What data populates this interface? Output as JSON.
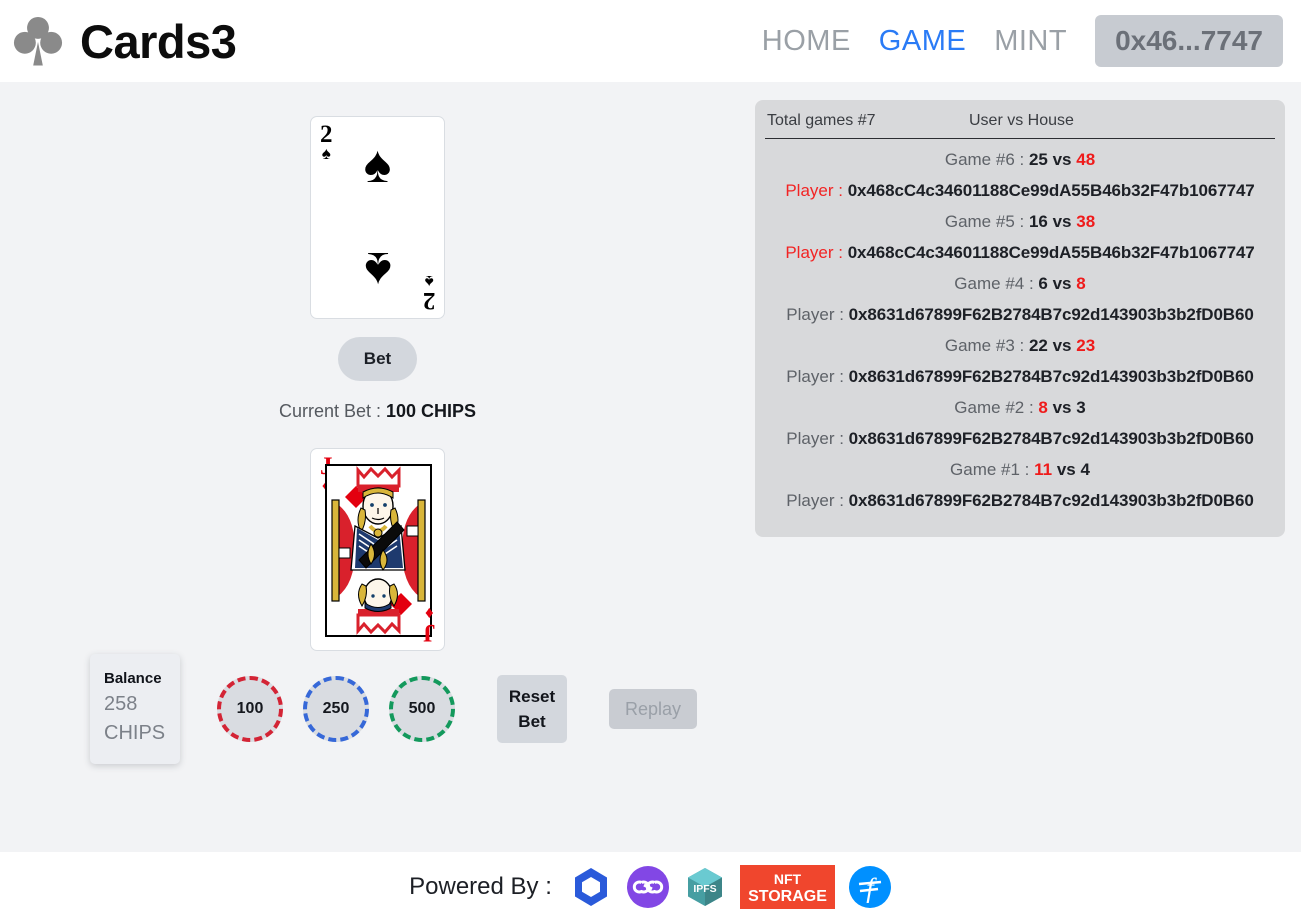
{
  "header": {
    "logo_icon": "club-suit-icon",
    "brand": "Cards3",
    "nav": [
      {
        "label": "HOME",
        "active": false
      },
      {
        "label": "GAME",
        "active": true
      },
      {
        "label": "MINT",
        "active": false
      }
    ],
    "wallet": "0x46...7747",
    "active_color": "#2a7bf6"
  },
  "game": {
    "house_card": {
      "rank": "2",
      "suit": "spade",
      "suit_glyph": "♠",
      "color": "black"
    },
    "player_card": {
      "rank": "J",
      "suit": "diamond",
      "suit_glyph": "♦",
      "color": "red"
    },
    "bet_button": "Bet",
    "current_bet_label": "Current Bet : ",
    "current_bet_value": "100 CHIPS"
  },
  "controls": {
    "balance_title": "Balance",
    "balance_value": "258",
    "balance_unit": "CHIPS",
    "chips": [
      {
        "value": "100",
        "color": "#d32435"
      },
      {
        "value": "250",
        "color": "#3668d8"
      },
      {
        "value": "500",
        "color": "#13995c"
      }
    ],
    "reset_label_line1": "Reset",
    "reset_label_line2": "Bet",
    "replay_label": "Replay",
    "replay_disabled": true
  },
  "history": {
    "total_games": "Total games #7",
    "column_header": "User vs House",
    "win_color": "#ef1b1b",
    "mine_color": "#f22424",
    "player_label": "Player : ",
    "entries": [
      {
        "game": "Game #6 : ",
        "user": "25",
        "vs": " vs ",
        "house": "48",
        "winner": "house",
        "player": "0x468cC4c34601188Ce99dA55B46b32F47b1067747",
        "is_mine": true
      },
      {
        "game": "Game #5 : ",
        "user": "16",
        "vs": " vs ",
        "house": "38",
        "winner": "house",
        "player": "0x468cC4c34601188Ce99dA55B46b32F47b1067747",
        "is_mine": true
      },
      {
        "game": "Game #4 : ",
        "user": "6",
        "vs": " vs ",
        "house": "8",
        "winner": "house",
        "player": "0x8631d67899F62B2784B7c92d143903b3b2fD0B60",
        "is_mine": false
      },
      {
        "game": "Game #3 : ",
        "user": "22",
        "vs": " vs ",
        "house": "23",
        "winner": "house",
        "player": "0x8631d67899F62B2784B7c92d143903b3b2fD0B60",
        "is_mine": false
      },
      {
        "game": "Game #2 : ",
        "user": "8",
        "vs": " vs ",
        "house": "3",
        "winner": "user",
        "player": "0x8631d67899F62B2784B7c92d143903b3b2fD0B60",
        "is_mine": false
      },
      {
        "game": "Game #1 : ",
        "user": "11",
        "vs": " vs ",
        "house": "4",
        "winner": "user",
        "player": "0x8631d67899F62B2784B7c92d143903b3b2fD0B60",
        "is_mine": false
      }
    ]
  },
  "footer": {
    "powered_by": "Powered By :",
    "logos": [
      {
        "name": "chainlink-logo",
        "color": "#2a5ada"
      },
      {
        "name": "polygon-logo",
        "color": "#8247e5"
      },
      {
        "name": "ipfs-logo",
        "text": "IPFS",
        "color": "#469ea2"
      },
      {
        "name": "nft-storage-logo",
        "text_line1": "NFT",
        "text_line2": "STORAGE",
        "color": "#f0462d"
      },
      {
        "name": "filecoin-logo",
        "color": "#0090ff"
      }
    ]
  }
}
